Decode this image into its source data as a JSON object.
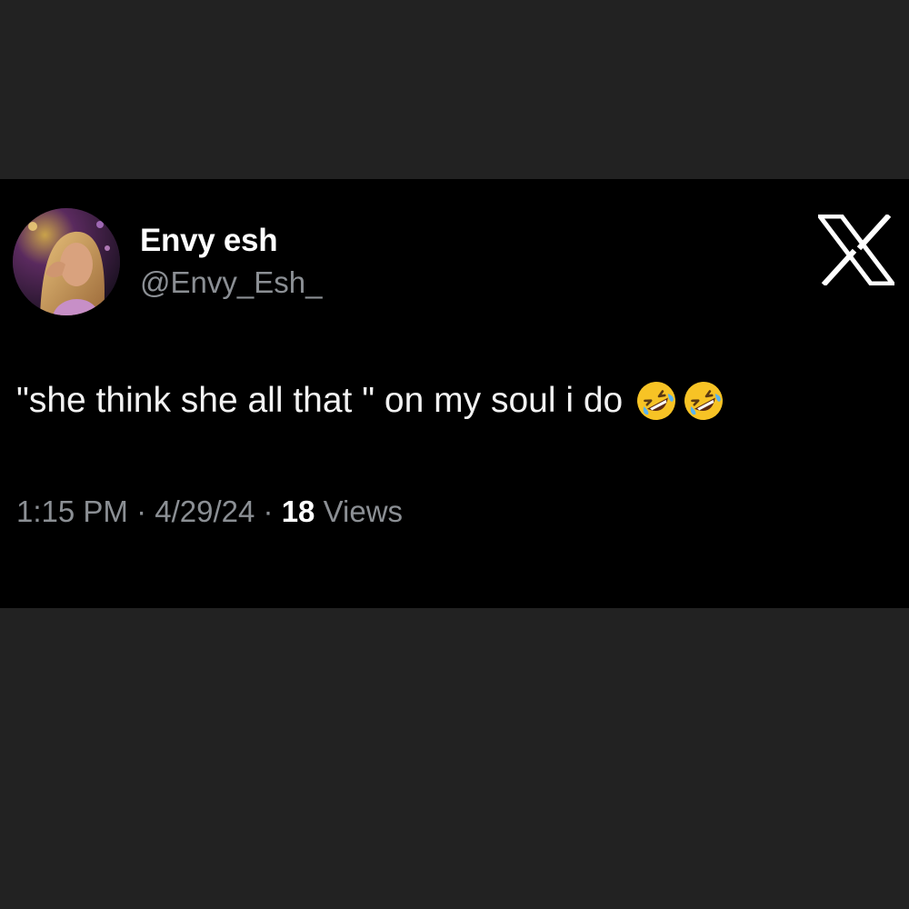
{
  "tweet": {
    "display_name": "Envy esh",
    "handle": "@Envy_Esh_",
    "text": "\"she think she all that \" on my soul i do",
    "emojis": [
      "rolling-on-floor-laughing-icon",
      "rolling-on-floor-laughing-icon"
    ],
    "time": "1:15 PM",
    "date": "4/29/24",
    "separator": "·",
    "views_count": "18",
    "views_label": "Views"
  },
  "branding": {
    "logo": "x-logo-icon"
  },
  "colors": {
    "page_background": "#222222",
    "card_background": "#000000",
    "primary_text": "#ffffff",
    "secondary_text": "#8b8f94"
  }
}
